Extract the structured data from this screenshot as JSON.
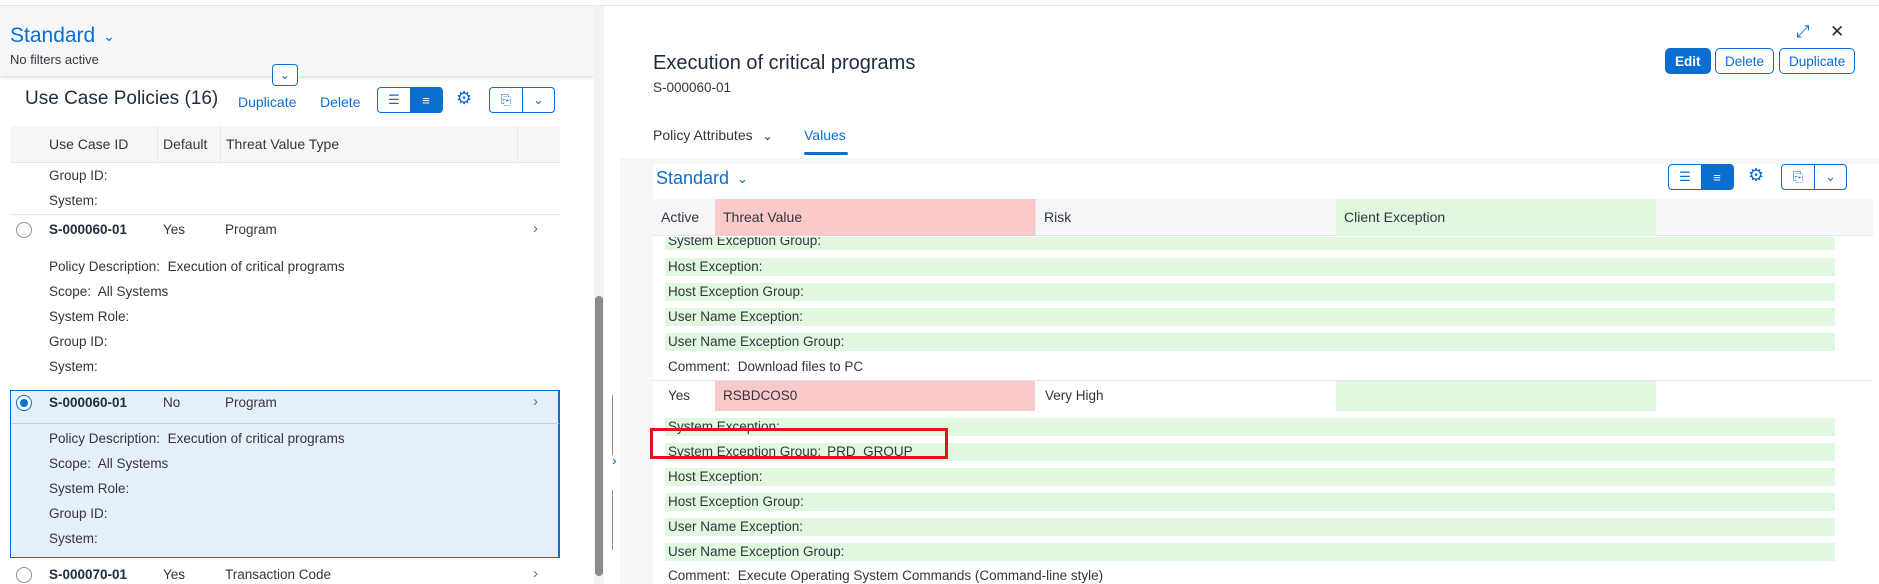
{
  "left": {
    "variant": "Standard",
    "filters": "No filters active",
    "table_title": "Use Case Policies (16)",
    "duplicate": "Duplicate",
    "delete": "Delete",
    "columns": [
      "Use Case ID",
      "Default",
      "Threat Value Type"
    ],
    "prev_tail": [
      {
        "label": "Group ID:",
        "value": ""
      },
      {
        "label": "System:",
        "value": ""
      }
    ],
    "rows": [
      {
        "id": "S-000060-01",
        "default": "Yes",
        "type": "Program",
        "selected": false,
        "details": [
          {
            "label": "Policy Description:",
            "value": "Execution of critical programs"
          },
          {
            "label": "Scope:",
            "value": "All Systems"
          },
          {
            "label": "System Role:",
            "value": ""
          },
          {
            "label": "Group ID:",
            "value": ""
          },
          {
            "label": "System:",
            "value": ""
          }
        ]
      },
      {
        "id": "S-000060-01",
        "default": "No",
        "type": "Program",
        "selected": true,
        "details": [
          {
            "label": "Policy Description:",
            "value": "Execution of critical programs"
          },
          {
            "label": "Scope:",
            "value": "All Systems"
          },
          {
            "label": "System Role:",
            "value": ""
          },
          {
            "label": "Group ID:",
            "value": ""
          },
          {
            "label": "System:",
            "value": ""
          }
        ]
      },
      {
        "id": "S-000070-01",
        "default": "Yes",
        "type": "Transaction Code",
        "selected": false
      }
    ]
  },
  "right": {
    "title": "Execution of critical programs",
    "subtitle": "S-000060-01",
    "edit": "Edit",
    "delete": "Delete",
    "duplicate": "Duplicate",
    "tabs": [
      "Policy Attributes",
      "Values"
    ],
    "variant": "Standard",
    "columns": [
      "Active",
      "Threat Value",
      "Risk",
      "Client Exception"
    ],
    "prev_lines": [
      {
        "label": "System Exception Group:",
        "value": ""
      },
      {
        "label": "Host Exception:",
        "value": ""
      },
      {
        "label": "Host Exception Group:",
        "value": ""
      },
      {
        "label": "User Name Exception:",
        "value": ""
      },
      {
        "label": "User Name Exception Group:",
        "value": ""
      },
      {
        "label": "Comment:",
        "value": "Download files to PC"
      }
    ],
    "row": {
      "active": "Yes",
      "threat_value": "RSBDCOS0",
      "risk": "Very High",
      "client_exception": ""
    },
    "row_lines": [
      {
        "label": "System Exception:",
        "value": ""
      },
      {
        "label": "System Exception Group:",
        "value": "PRD_GROUP"
      },
      {
        "label": "Host Exception:",
        "value": ""
      },
      {
        "label": "Host Exception Group:",
        "value": ""
      },
      {
        "label": "User Name Exception:",
        "value": ""
      },
      {
        "label": "User Name Exception Group:",
        "value": ""
      },
      {
        "label": "Comment:",
        "value": "Execute Operating System Commands (Command-line style)"
      }
    ]
  },
  "colors": {
    "accent": "#0a6ed1",
    "pink": "#fac9c9",
    "green": "#e0f7e0",
    "highlight": "#e0141c"
  }
}
